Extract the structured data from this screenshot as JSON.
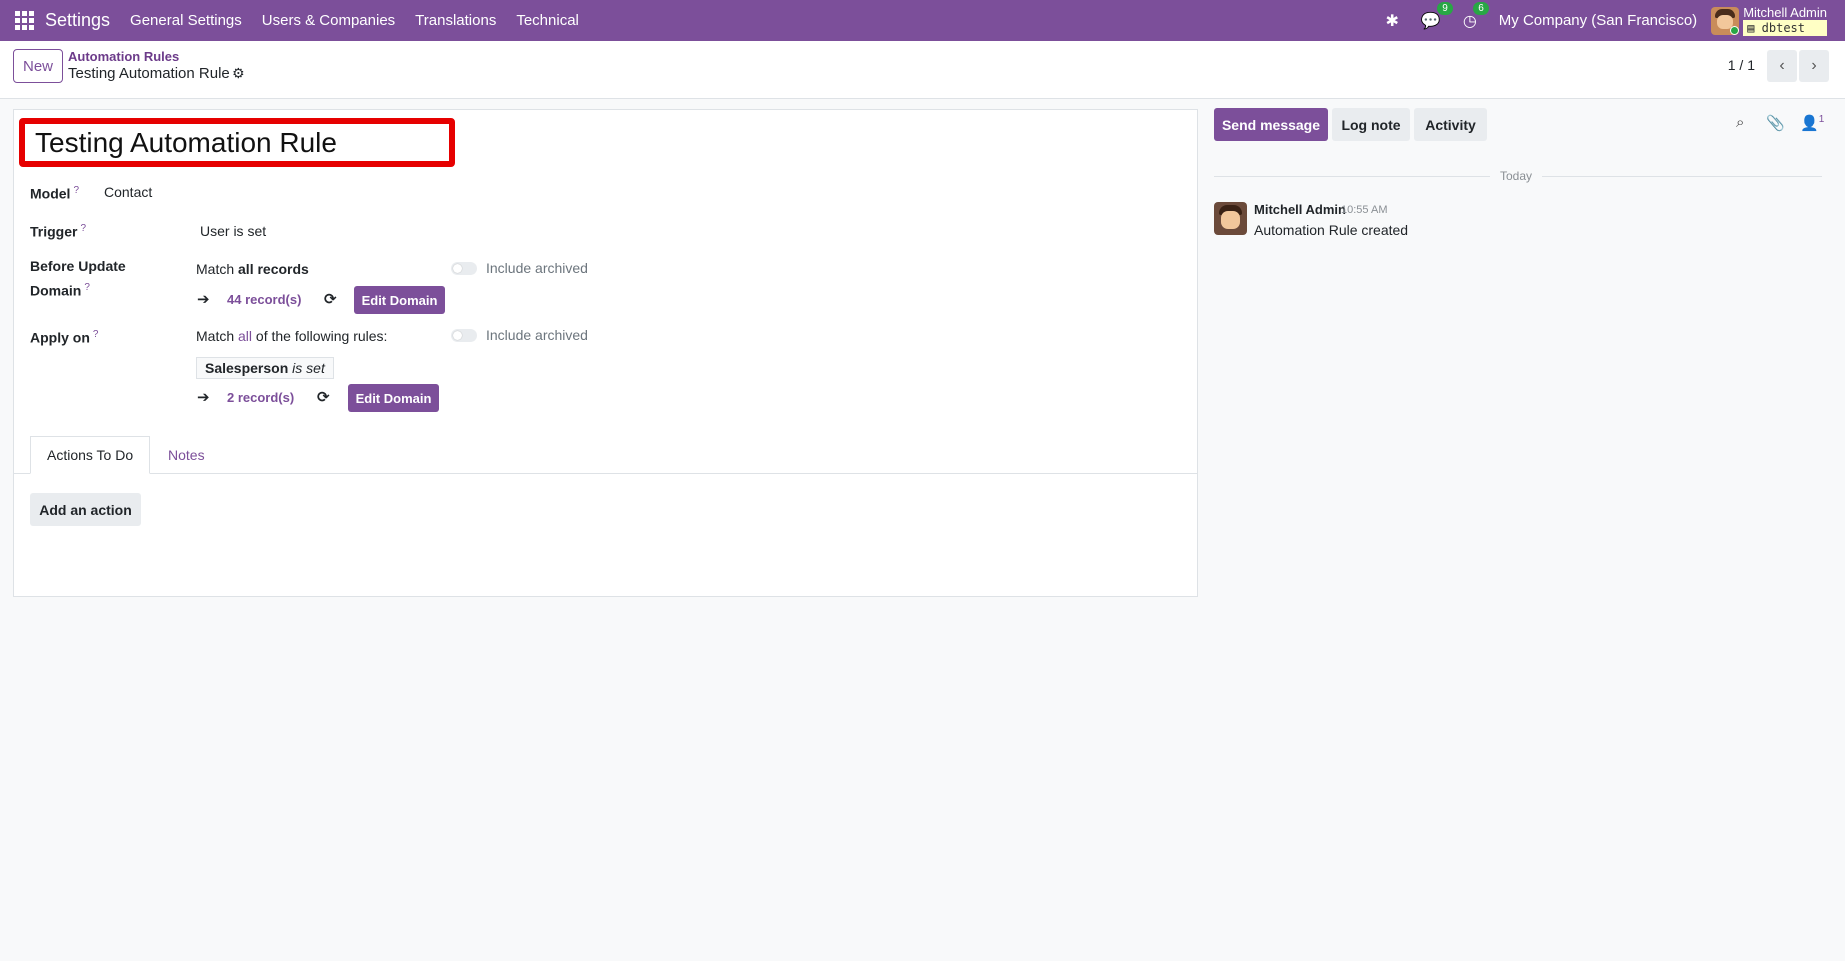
{
  "navbar": {
    "app_name": "Settings",
    "menu": [
      "General Settings",
      "Users & Companies",
      "Translations",
      "Technical"
    ],
    "messages_badge": "9",
    "activity_badge": "6",
    "company": "My Company (San Francisco)",
    "user_name": "Mitchell Admin",
    "db_name": "dbtest"
  },
  "control": {
    "new_label": "New",
    "breadcrumb_parent": "Automation Rules",
    "breadcrumb_current": "Testing Automation Rule",
    "pager": "1 / 1"
  },
  "form": {
    "name": "Testing Automation Rule",
    "model_label": "Model",
    "model_value": "Contact",
    "trigger_label": "Trigger",
    "trigger_value": "User is set",
    "before_update_label_1": "Before Update",
    "before_update_label_2": "Domain",
    "before_match_prefix": "Match ",
    "before_match_bold": "all records",
    "include_archived": "Include archived",
    "before_records": "44 record(s)",
    "edit_domain": "Edit Domain",
    "apply_on_label": "Apply on",
    "apply_match_prefix": "Match ",
    "apply_match_all": "all",
    "apply_match_suffix": " of the following rules:",
    "rule_field": "Salesperson",
    "rule_op": "is set",
    "apply_records": "2 record(s)",
    "help_mark": "?",
    "arrow": "➔"
  },
  "tabs": {
    "actions": "Actions To Do",
    "notes": "Notes"
  },
  "actions": {
    "add_action": "Add an action"
  },
  "chatter": {
    "send_message": "Send message",
    "log_note": "Log note",
    "activity": "Activity",
    "followers_count": "1",
    "date_separator": "Today",
    "author": "Mitchell Admin",
    "time": "10:55 AM",
    "body": "Automation Rule created"
  },
  "colors": {
    "brand": "#7c4f9a",
    "highlight": "#e60000"
  }
}
